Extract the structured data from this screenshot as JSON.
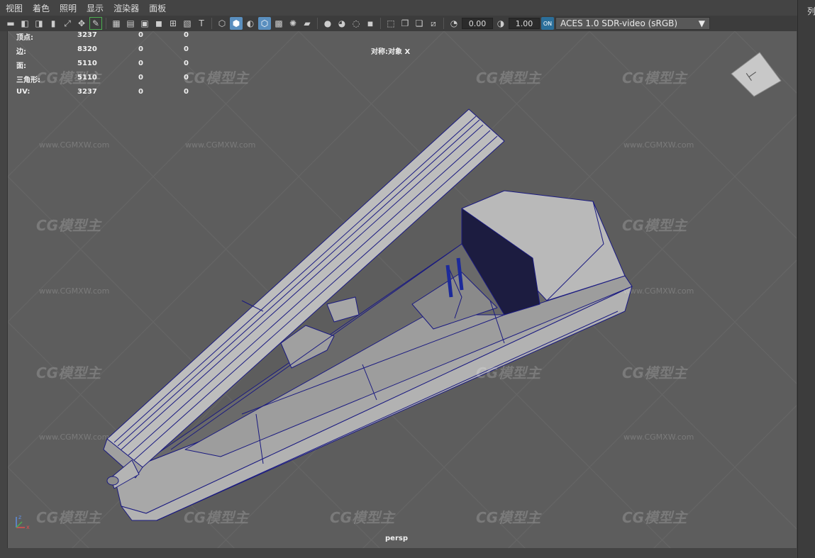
{
  "menubar": {
    "items": [
      "视图",
      "着色",
      "照明",
      "显示",
      "渲染器",
      "面板"
    ]
  },
  "toolbar": {
    "value1": "0.00",
    "value2": "1.00",
    "color_badge": "ON",
    "colorspace": "ACES 1.0 SDR-video (sRGB)"
  },
  "hud": {
    "rows": [
      {
        "label": "顶点:",
        "v1": "3237",
        "v2": "0",
        "v3": "0"
      },
      {
        "label": "边:",
        "v1": "8320",
        "v2": "0",
        "v3": "0"
      },
      {
        "label": "面:",
        "v1": "5110",
        "v2": "0",
        "v3": "0"
      },
      {
        "label": "三角形:",
        "v1": "5110",
        "v2": "0",
        "v3": "0"
      },
      {
        "label": "UV:",
        "v1": "3237",
        "v2": "0",
        "v3": "0"
      }
    ],
    "object_label": "对称:对象 X",
    "camera": "persp"
  },
  "right_panel": {
    "label": "列"
  },
  "watermark": {
    "logo": "CG模型主",
    "url": "www.CGMXW.com"
  },
  "colors": {
    "viewport_bg": "#5d5d5d",
    "mesh_fill": "#b4b4b4",
    "wire": "#1a1a80",
    "accent": "#5a8fbf"
  }
}
